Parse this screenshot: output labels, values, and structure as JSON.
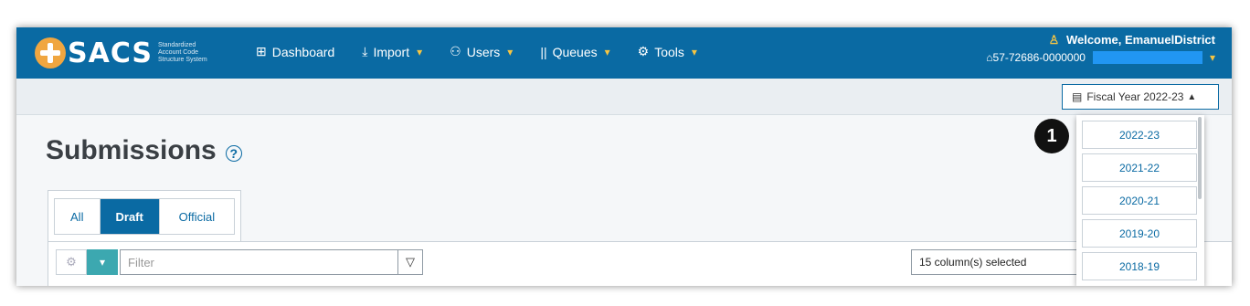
{
  "brand": {
    "name": "SACS",
    "subtitle_line1": "Standardized",
    "subtitle_line2": "Account Code",
    "subtitle_line3": "Structure System"
  },
  "nav": [
    {
      "label": "Dashboard",
      "icon": "dashboard-icon",
      "has_chevron": false
    },
    {
      "label": "Import",
      "icon": "import-icon",
      "has_chevron": true
    },
    {
      "label": "Users",
      "icon": "users-icon",
      "has_chevron": true
    },
    {
      "label": "Queues",
      "icon": "queues-icon",
      "has_chevron": true
    },
    {
      "label": "Tools",
      "icon": "gear-icon",
      "has_chevron": true
    }
  ],
  "user": {
    "welcome": "Welcome, EmanuelDistrict",
    "district_code": "57-72686-0000000"
  },
  "fiscal_year": {
    "button_label": "Fiscal Year 2022-23",
    "options": [
      "2022-23",
      "2021-22",
      "2020-21",
      "2019-20",
      "2018-19"
    ]
  },
  "page": {
    "title": "Submissions",
    "help_icon": "?"
  },
  "tabs": [
    {
      "label": "All",
      "active": false
    },
    {
      "label": "Draft",
      "active": true
    },
    {
      "label": "Official",
      "active": false
    }
  ],
  "toolbar": {
    "filter_placeholder": "Filter",
    "columns_selected": "15 column(s) selected"
  },
  "callout": {
    "number": "1"
  },
  "colors": {
    "header_bg": "#0a6aa3",
    "accent_yellow": "#f6c542",
    "logo_orange": "#f0a640",
    "teal_button": "#3ca8b0"
  }
}
